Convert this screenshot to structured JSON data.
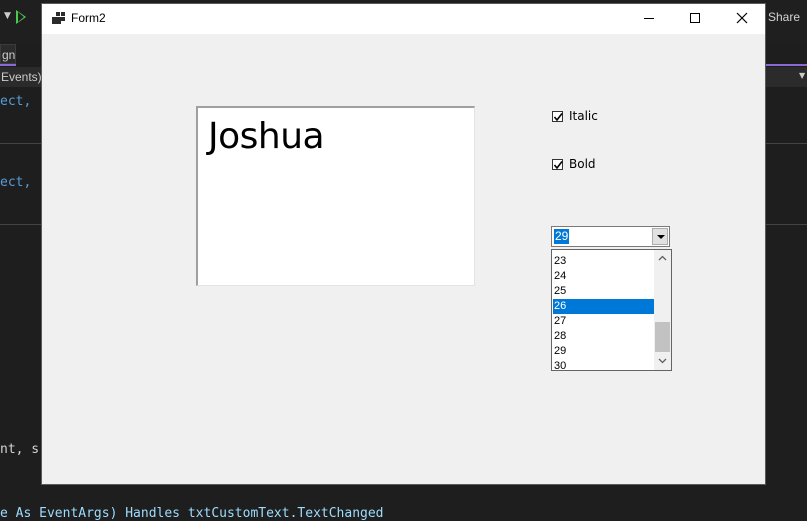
{
  "ide": {
    "share_label": "Share",
    "combo_1_text": "gn]",
    "combo_2_text": "Events)",
    "code_fragment_1": "ect, ",
    "code_fragment_2": "ect, ",
    "code_fragment_3": "nt, s",
    "code_bottom": "e As EventArgs) Handles txtCustomText.TextChanged"
  },
  "window": {
    "title": "Form2"
  },
  "text_box": {
    "value": "Joshua"
  },
  "options": {
    "italic_label": "Italic",
    "italic_checked": true,
    "bold_label": "Bold",
    "bold_checked": true
  },
  "font_size": {
    "selected_value": "29",
    "highlighted_item": "26",
    "items": [
      "23",
      "24",
      "25",
      "26",
      "27",
      "28",
      "29",
      "30"
    ]
  },
  "colors": {
    "selection": "#0078d7",
    "form_background": "#f0f0f0",
    "ide_background": "#1e1e1e"
  }
}
